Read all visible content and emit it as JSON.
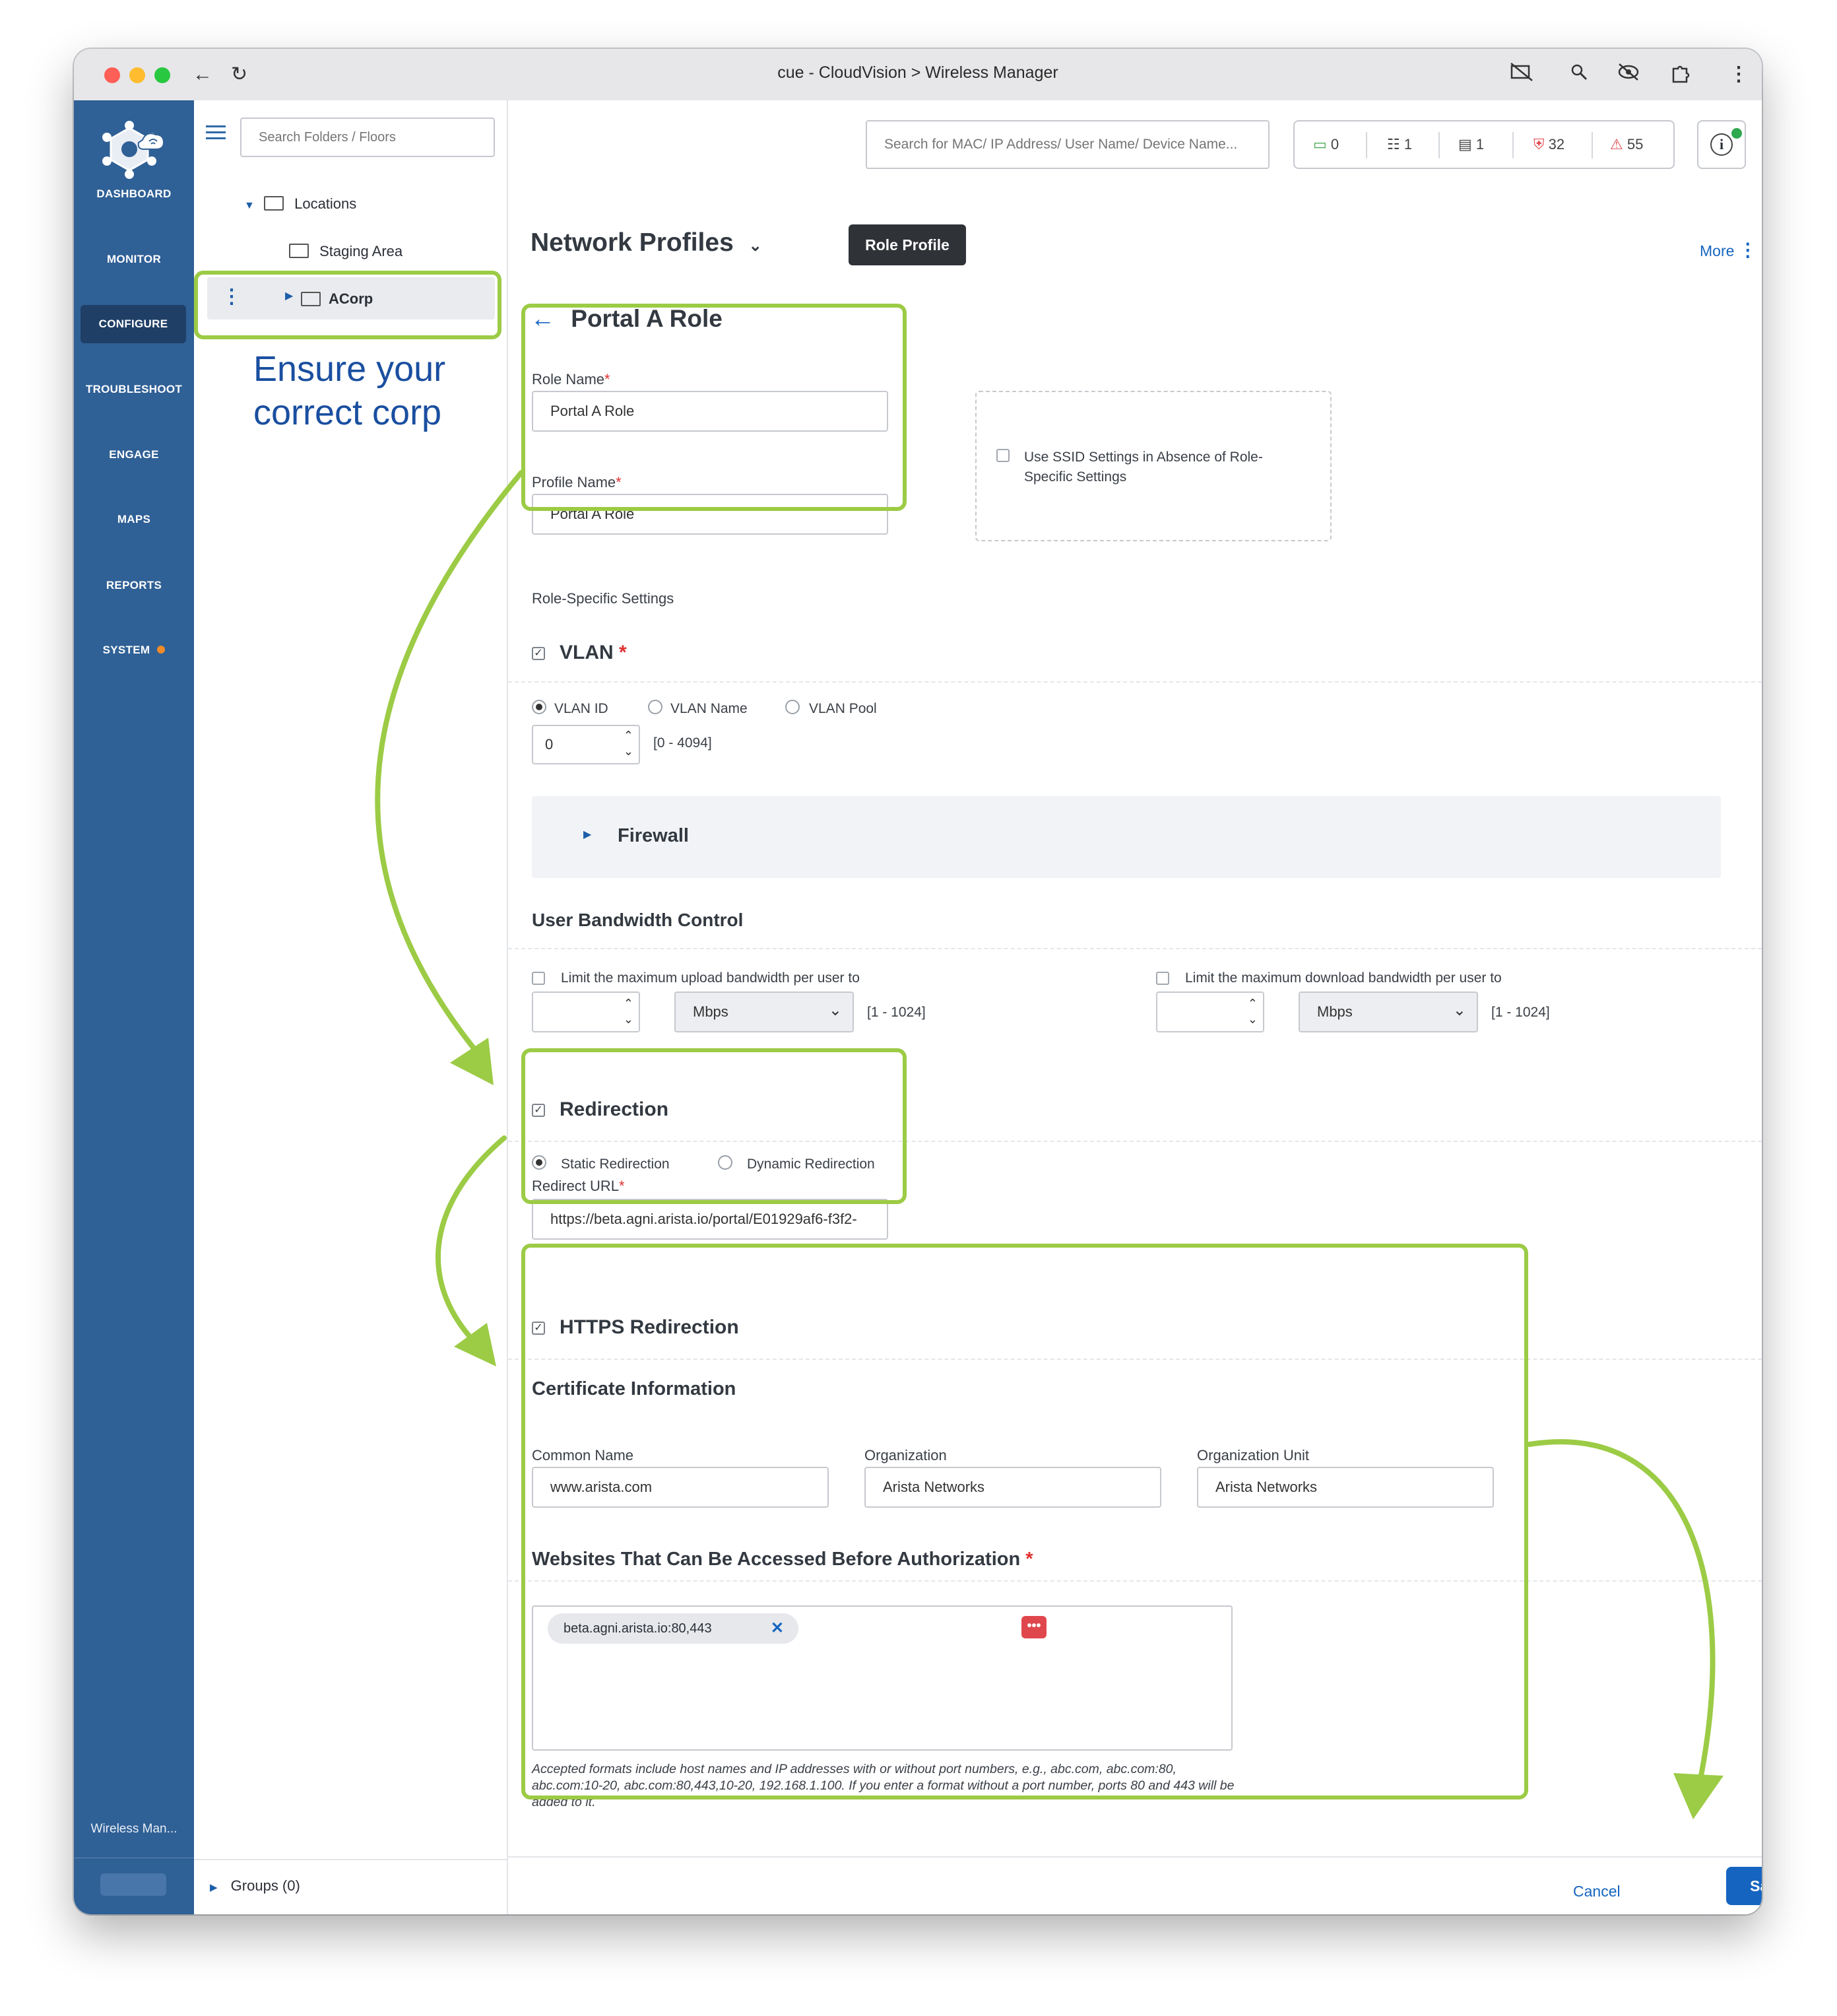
{
  "window": {
    "title": "cue - CloudVision > Wireless Manager"
  },
  "sidebar": {
    "items": [
      {
        "label": "DASHBOARD"
      },
      {
        "label": "MONITOR"
      },
      {
        "label": "CONFIGURE"
      },
      {
        "label": "TROUBLESHOOT"
      },
      {
        "label": "ENGAGE"
      },
      {
        "label": "MAPS"
      },
      {
        "label": "REPORTS"
      },
      {
        "label": "SYSTEM"
      }
    ],
    "footer_label": "Wireless Man..."
  },
  "tree": {
    "search_placeholder": "Search Folders / Floors",
    "locations": "Locations",
    "staging": "Staging Area",
    "acorp": "ACorp",
    "groups": "Groups (0)"
  },
  "annotation": {
    "line1": "Ensure your",
    "line2": "correct corp"
  },
  "header": {
    "search_placeholder": "Search for MAC/ IP Address/ User Name/ Device Name...",
    "counts": {
      "clients": "0",
      "switches": "1",
      "aps": "1",
      "security": "32",
      "alerts": "55"
    },
    "page_title": "Network Profiles",
    "tooltip": "Role Profile",
    "more": "More"
  },
  "form": {
    "back_title": "Portal A Role",
    "role_name_label": "Role Name",
    "role_name_value": "Portal A Role",
    "profile_name_label": "Profile Name",
    "profile_name_value": "Portal A Role",
    "ssid_option": "Use SSID Settings in Absence of Role-Specific Settings",
    "role_specific": "Role-Specific Settings",
    "vlan": {
      "title": "VLAN",
      "opt_id": "VLAN ID",
      "opt_name": "VLAN Name",
      "opt_pool": "VLAN Pool",
      "value": "0",
      "range": "[0 - 4094]"
    },
    "firewall": "Firewall",
    "bandwidth": {
      "title": "User Bandwidth Control",
      "upload_label": "Limit the maximum upload bandwidth per user to",
      "download_label": "Limit the maximum download bandwidth per user to",
      "unit": "Mbps",
      "range": "[1 - 1024]"
    },
    "redirection": {
      "title": "Redirection",
      "static": "Static Redirection",
      "dynamic": "Dynamic Redirection",
      "url_label": "Redirect URL",
      "url_value": "https://beta.agni.arista.io/portal/E01929af6-f3f2-"
    },
    "https": {
      "title": "HTTPS Redirection",
      "cert_title": "Certificate Information",
      "cn_label": "Common Name",
      "cn_value": "www.arista.com",
      "org_label": "Organization",
      "org_value": "Arista Networks",
      "ou_label": "Organization Unit",
      "ou_value": "Arista Networks",
      "sites_title": "Websites That Can Be Accessed Before Authorization",
      "site_tag": "beta.agni.arista.io:80,443",
      "help": "Accepted formats include host names and IP addresses with or without port numbers, e.g., abc.com, abc.com:80, abc.com:10-20, abc.com:80,443,10-20, 192.168.1.100. If you enter a format without a port number, ports 80 and 443 will be added to it."
    }
  },
  "footer": {
    "cancel": "Cancel",
    "save": "Save"
  },
  "colors": {
    "sidebar": "#2f6096",
    "accent": "#1565c0",
    "highlight": "#9ccb45",
    "annotation_text": "#1a4fa0"
  }
}
